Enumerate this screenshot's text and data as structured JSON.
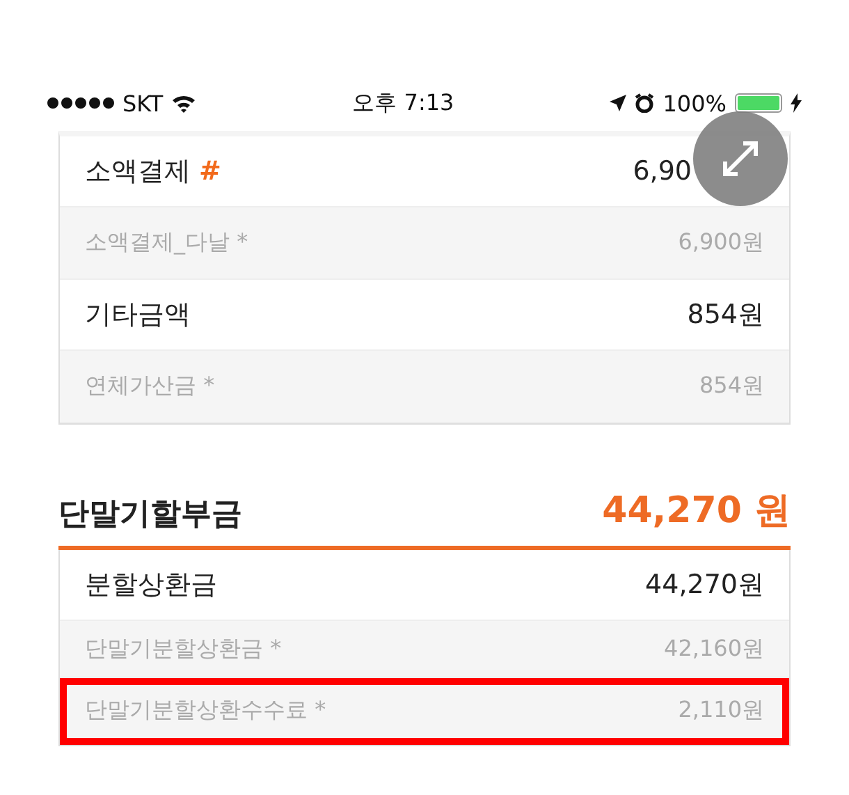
{
  "status_bar": {
    "carrier": "SKT",
    "time": "오후 7:13",
    "battery": "100%"
  },
  "top_rows": [
    {
      "kind": "main",
      "label": "소액결제",
      "mark": "#",
      "value": "6,90",
      "highlighted": false,
      "under_button": true
    },
    {
      "kind": "sub",
      "label": "소액결제_다날 *",
      "value": "6,900원",
      "highlighted": false
    },
    {
      "kind": "main",
      "label": "기타금액",
      "value": "854원",
      "highlighted": false
    },
    {
      "kind": "sub",
      "label": "연체가산금 *",
      "value": "854원",
      "highlighted": false
    }
  ],
  "section": {
    "title": "단말기할부금",
    "total": "44,270 원"
  },
  "section_rows": [
    {
      "kind": "main",
      "label": "분할상환금",
      "value": "44,270원",
      "highlighted": false
    },
    {
      "kind": "sub",
      "label": "단말기분할상환금 *",
      "value": "42,160원",
      "highlighted": false
    },
    {
      "kind": "sub",
      "label": "단말기분할상환수수료 *",
      "value": "2,110원",
      "highlighted": true
    }
  ]
}
